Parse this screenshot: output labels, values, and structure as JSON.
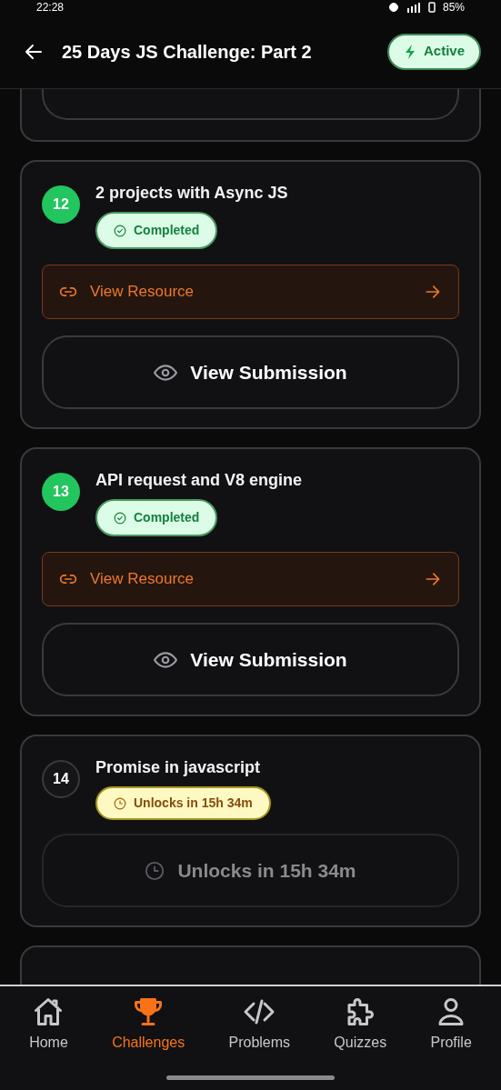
{
  "status_bar": {
    "time": "22:28",
    "battery": "85%"
  },
  "header": {
    "title": "25 Days JS Challenge: Part 2",
    "badge": "Active"
  },
  "challenges": [
    {
      "kind": "partial_top"
    },
    {
      "kind": "completed",
      "number": "12",
      "title": "2 projects with Async JS",
      "status": "Completed",
      "resource": "View Resource",
      "action": "View Submission"
    },
    {
      "kind": "completed",
      "number": "13",
      "title": "API request and V8 engine",
      "status": "Completed",
      "resource": "View Resource",
      "action": "View Submission"
    },
    {
      "kind": "locked",
      "number": "14",
      "title": "Promise in javascript",
      "status": "Unlocks in 15h 34m",
      "action": "Unlocks in 15h 34m"
    },
    {
      "kind": "partial_bottom"
    }
  ],
  "nav": [
    {
      "label": "Home",
      "selected": false
    },
    {
      "label": "Challenges",
      "selected": true
    },
    {
      "label": "Problems",
      "selected": false
    },
    {
      "label": "Quizzes",
      "selected": false
    },
    {
      "label": "Profile",
      "selected": false
    }
  ]
}
